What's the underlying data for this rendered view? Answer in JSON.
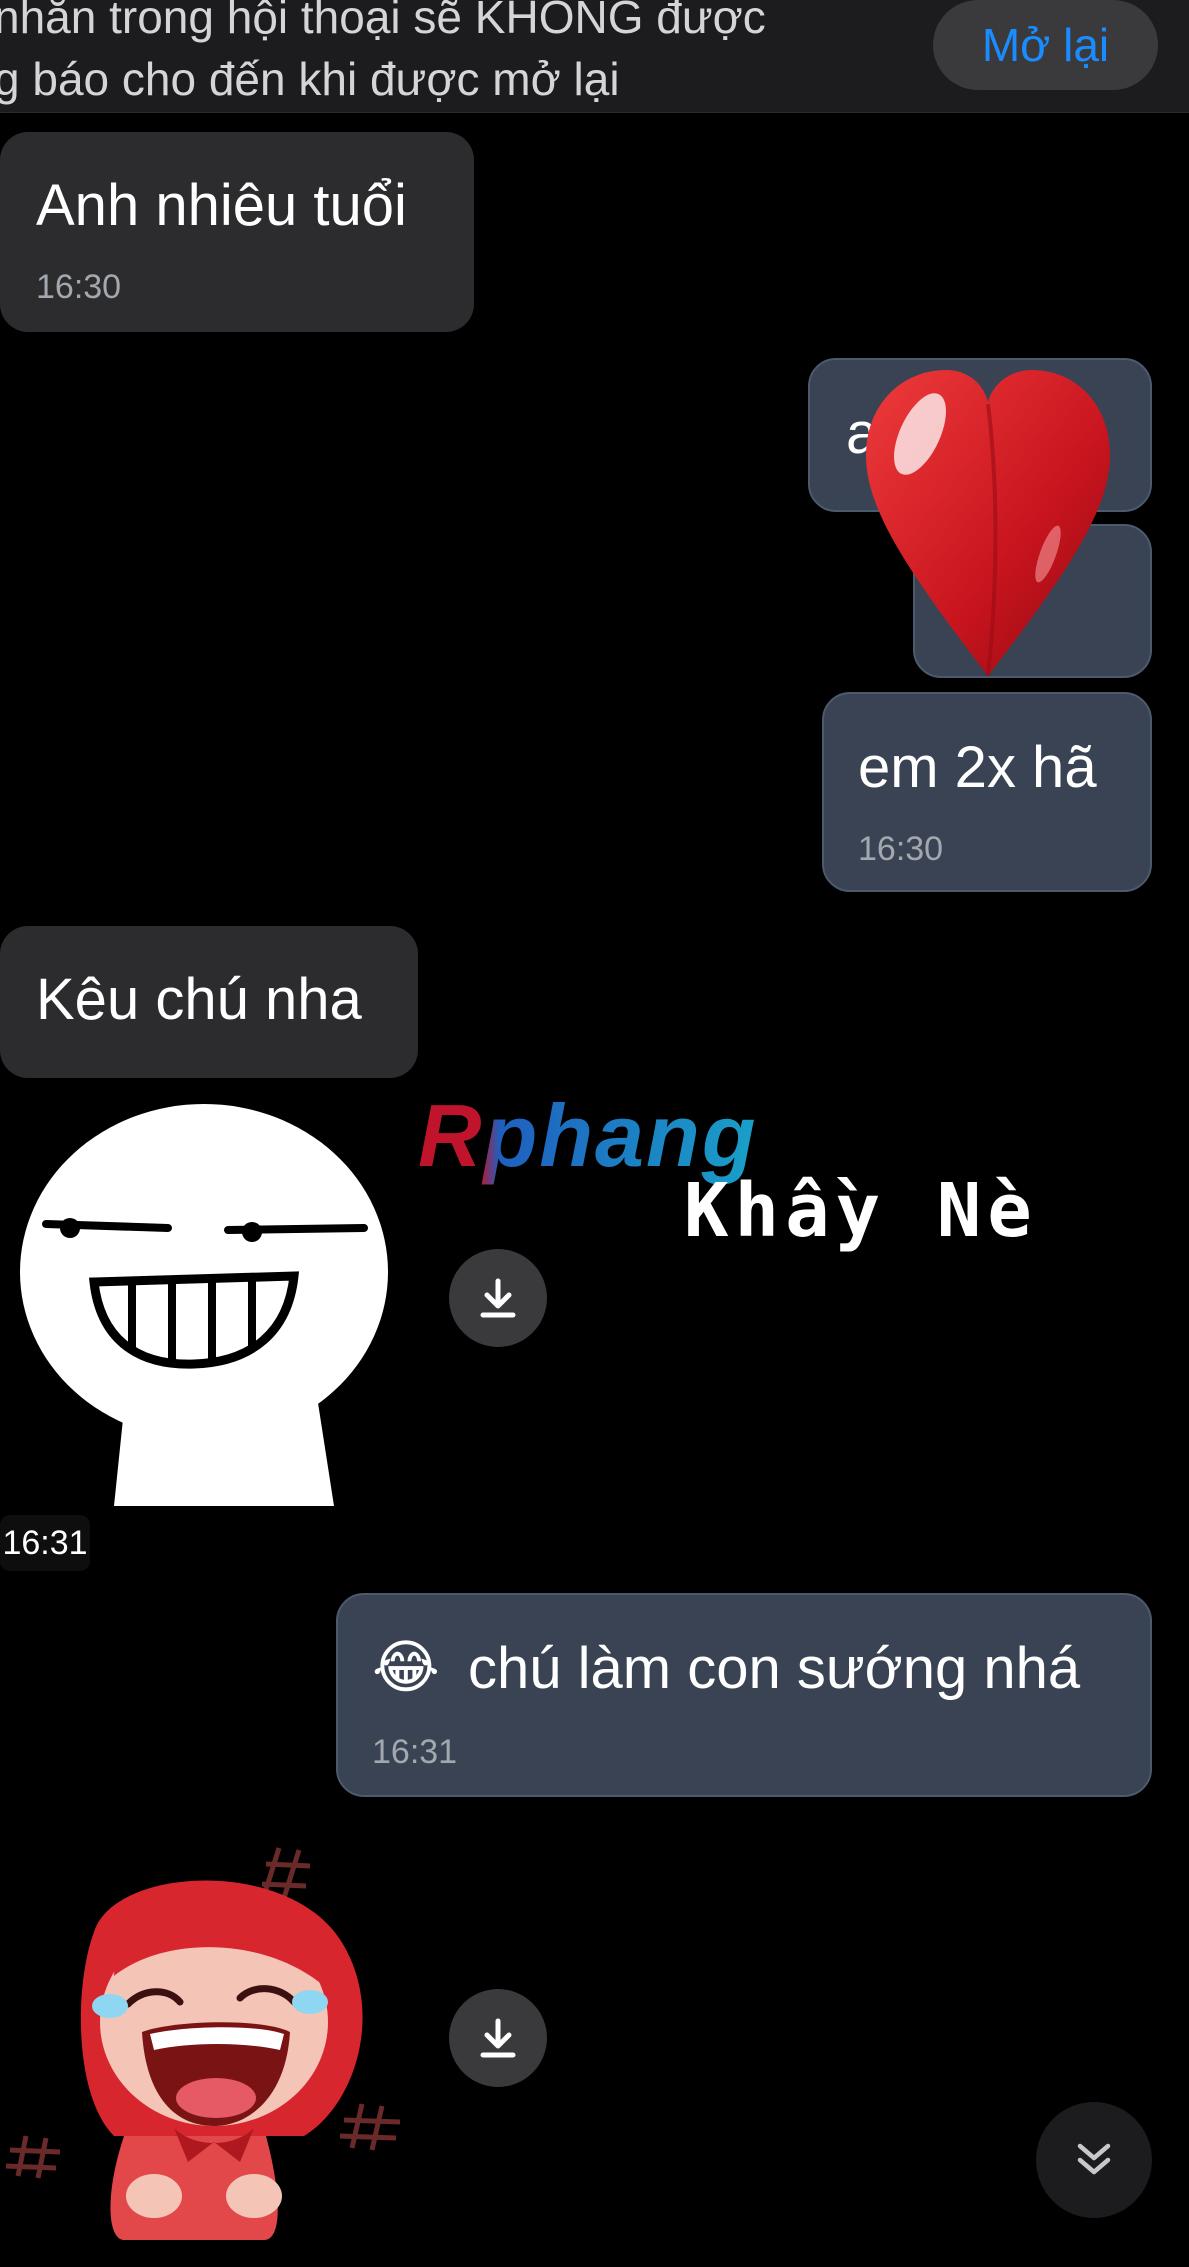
{
  "banner": {
    "line1": "nhắn trong hội thoại sẽ KHÔNG được",
    "line2": "g báo cho đến khi được mở lại",
    "reopen_label": "Mở lại"
  },
  "messages": [
    {
      "side": "in",
      "text": "Anh nhiêu tuổi",
      "time": "16:30"
    },
    {
      "side": "out",
      "text": "a"
    },
    {
      "side": "out",
      "text": "em 2x hã",
      "time": "16:30"
    },
    {
      "side": "in",
      "text": "Kêu chú nha"
    },
    {
      "side": "in",
      "kind": "sticker",
      "name": "grinning-face-sticker",
      "time": "16:31"
    },
    {
      "side": "out",
      "emoji": "😂",
      "text": "chú làm con sướng nhá",
      "time": "16:31"
    },
    {
      "side": "in",
      "kind": "sticker",
      "name": "laughing-girl-sticker"
    }
  ],
  "watermark": {
    "logo": "Rphang",
    "name": "Khầy Nè"
  },
  "colors": {
    "accent": "#1a8cff",
    "incoming_bubble": "#2c2c2e",
    "outgoing_bubble": "#3a4353",
    "heart": "#d9202b"
  },
  "icons": {
    "download": "download-icon",
    "scroll_down": "chevron-double-down-icon",
    "reaction": "heart-icon"
  }
}
